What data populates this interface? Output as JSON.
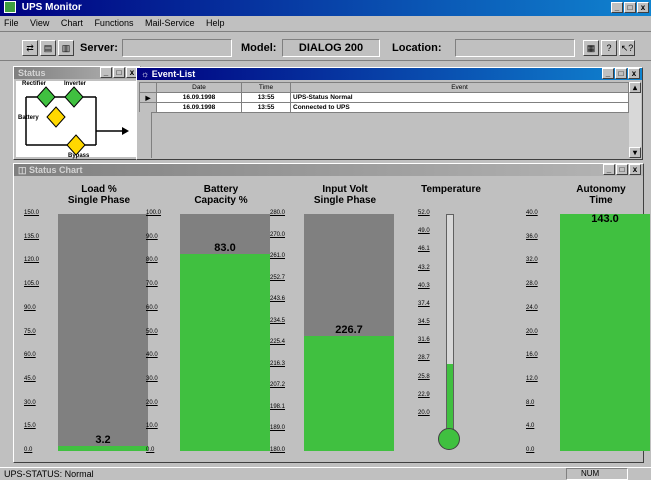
{
  "app": {
    "title": "UPS Monitor"
  },
  "menu": [
    "File",
    "View",
    "Chart",
    "Functions",
    "Mail-Service",
    "Help"
  ],
  "toolbar": {
    "server_label": "Server:",
    "server_value": "",
    "model_label": "Model:",
    "model_value": "DIALOG 200",
    "location_label": "Location:",
    "location_value": ""
  },
  "status_window": {
    "title": "Status",
    "rectifier": "Rectifier",
    "inverter": "Inverter",
    "battery": "Battery",
    "bypass": "Bypass"
  },
  "event_list": {
    "title": "Event-List",
    "columns": [
      "Date",
      "Time",
      "Event"
    ],
    "rows": [
      {
        "date": "16.09.1998",
        "time": "13:55",
        "event": "UPS-Status Normal"
      },
      {
        "date": "16.09.1998",
        "time": "13:55",
        "event": "Connected to UPS"
      }
    ]
  },
  "status_chart": {
    "title": "Status Chart",
    "gauges": [
      {
        "title1": "Load %",
        "title2": "Single Phase",
        "value": "3.2",
        "fraction": 0.021,
        "ticks": [
          "150.0",
          "135.0",
          "120.0",
          "105.0",
          "90.0",
          "75.0",
          "60.0",
          "45.0",
          "30.0",
          "15.0",
          "0.0"
        ]
      },
      {
        "title1": "Battery",
        "title2": "Capacity %",
        "value": "83.0",
        "fraction": 0.83,
        "ticks": [
          "100.0",
          "90.0",
          "80.0",
          "70.0",
          "60.0",
          "50.0",
          "40.0",
          "30.0",
          "20.0",
          "10.0",
          "0.0"
        ]
      },
      {
        "title1": "Input Volt",
        "title2": "Single Phase",
        "value": "226.7",
        "fraction": 0.487,
        "ticks": [
          "280.0",
          "270.0",
          "261.0",
          "252.7",
          "243.6",
          "234.5",
          "225.4",
          "216.3",
          "207.2",
          "198.1",
          "189.0",
          "180.0"
        ]
      },
      {
        "title1": "Autonomy",
        "title2": "Time",
        "value": "143.0",
        "fraction": 1.0,
        "ticks": [
          "40.0",
          "36.0",
          "32.0",
          "28.0",
          "24.0",
          "20.0",
          "16.0",
          "12.0",
          "8.0",
          "4.0",
          "0.0"
        ]
      }
    ],
    "temperature": {
      "title": "Temperature",
      "fraction": 0.31,
      "ticks": [
        "52.0",
        "49.0",
        "46.1",
        "43.2",
        "40.3",
        "37.4",
        "34.5",
        "31.6",
        "28.7",
        "25.8",
        "22.9",
        "20.0"
      ]
    }
  },
  "statusbar": {
    "text": "UPS-STATUS: Normal",
    "num": "NUM"
  },
  "colors": {
    "fill": "#40c040",
    "track": "#808080",
    "title_active": "#000080"
  }
}
